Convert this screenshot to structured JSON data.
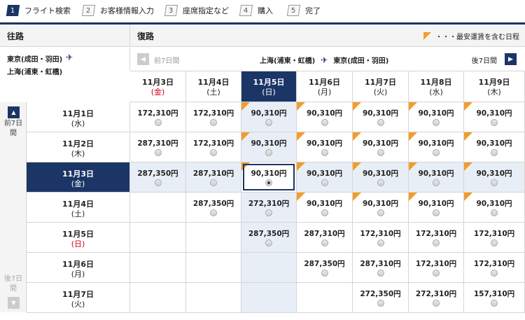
{
  "steps": [
    {
      "num": "1",
      "label": "フライト検索",
      "active": true
    },
    {
      "num": "2",
      "label": "お客様情報入力",
      "active": false
    },
    {
      "num": "3",
      "label": "座席指定など",
      "active": false
    },
    {
      "num": "4",
      "label": "購入",
      "active": false
    },
    {
      "num": "5",
      "label": "完了",
      "active": false
    }
  ],
  "outbound": {
    "title": "往路",
    "from": "東京(成田・羽田)",
    "to": "上海(浦東・虹橋)"
  },
  "return": {
    "title": "復路",
    "from": "上海(浦東・虹橋)",
    "to": "東京(成田・羽田)",
    "prev_label": "前7日間",
    "next_label": "後7日間"
  },
  "legend": {
    "text": "・・・最安運賃を含む日程"
  },
  "side": {
    "up_label": "前7日間",
    "down_label": "後7日間"
  },
  "columns": [
    {
      "date": "11月3日",
      "wday": "(金)",
      "wday_red": true,
      "selected": false
    },
    {
      "date": "11月4日",
      "wday": "(土)",
      "wday_red": false,
      "selected": false
    },
    {
      "date": "11月5日",
      "wday": "(日)",
      "wday_red": false,
      "selected": true
    },
    {
      "date": "11月6日",
      "wday": "(月)",
      "wday_red": false,
      "selected": false
    },
    {
      "date": "11月7日",
      "wday": "(火)",
      "wday_red": false,
      "selected": false
    },
    {
      "date": "11月8日",
      "wday": "(水)",
      "wday_red": false,
      "selected": false
    },
    {
      "date": "11月9日",
      "wday": "(木)",
      "wday_red": false,
      "selected": false
    }
  ],
  "rows": [
    {
      "date": "11月1日",
      "wday": "(水)",
      "wday_red": false,
      "selected": false,
      "cells": [
        {
          "p": "172,310円",
          "c": false
        },
        {
          "p": "172,310円",
          "c": false
        },
        {
          "p": "90,310円",
          "c": true
        },
        {
          "p": "90,310円",
          "c": true
        },
        {
          "p": "90,310円",
          "c": true
        },
        {
          "p": "90,310円",
          "c": true
        },
        {
          "p": "90,310円",
          "c": true
        }
      ]
    },
    {
      "date": "11月2日",
      "wday": "(木)",
      "wday_red": false,
      "selected": false,
      "cells": [
        {
          "p": "287,310円",
          "c": false
        },
        {
          "p": "172,310円",
          "c": false
        },
        {
          "p": "90,310円",
          "c": true
        },
        {
          "p": "90,310円",
          "c": true
        },
        {
          "p": "90,310円",
          "c": true
        },
        {
          "p": "90,310円",
          "c": true
        },
        {
          "p": "90,310円",
          "c": true
        }
      ]
    },
    {
      "date": "11月3日",
      "wday": "(金)",
      "wday_red": false,
      "selected": true,
      "cells": [
        {
          "p": "287,350円",
          "c": false
        },
        {
          "p": "287,310円",
          "c": false
        },
        {
          "p": "90,310円",
          "c": true,
          "sel": true
        },
        {
          "p": "90,310円",
          "c": true
        },
        {
          "p": "90,310円",
          "c": true
        },
        {
          "p": "90,310円",
          "c": true
        },
        {
          "p": "90,310円",
          "c": true
        }
      ]
    },
    {
      "date": "11月4日",
      "wday": "(土)",
      "wday_red": false,
      "selected": false,
      "cells": [
        {
          "p": "",
          "c": false
        },
        {
          "p": "287,350円",
          "c": false
        },
        {
          "p": "272,310円",
          "c": false
        },
        {
          "p": "90,310円",
          "c": true
        },
        {
          "p": "90,310円",
          "c": true
        },
        {
          "p": "90,310円",
          "c": true
        },
        {
          "p": "90,310円",
          "c": true
        }
      ]
    },
    {
      "date": "11月5日",
      "wday": "(日)",
      "wday_red": true,
      "selected": false,
      "cells": [
        {
          "p": "",
          "c": false
        },
        {
          "p": "",
          "c": false
        },
        {
          "p": "287,350円",
          "c": false
        },
        {
          "p": "287,310円",
          "c": false
        },
        {
          "p": "172,310円",
          "c": false
        },
        {
          "p": "172,310円",
          "c": false
        },
        {
          "p": "172,310円",
          "c": false
        }
      ]
    },
    {
      "date": "11月6日",
      "wday": "(月)",
      "wday_red": false,
      "selected": false,
      "cells": [
        {
          "p": "",
          "c": false
        },
        {
          "p": "",
          "c": false
        },
        {
          "p": "",
          "c": false
        },
        {
          "p": "287,350円",
          "c": false
        },
        {
          "p": "287,310円",
          "c": false
        },
        {
          "p": "172,310円",
          "c": false
        },
        {
          "p": "172,310円",
          "c": false
        }
      ]
    },
    {
      "date": "11月7日",
      "wday": "(火)",
      "wday_red": false,
      "selected": false,
      "cells": [
        {
          "p": "",
          "c": false
        },
        {
          "p": "",
          "c": false
        },
        {
          "p": "",
          "c": false
        },
        {
          "p": "",
          "c": false
        },
        {
          "p": "272,350円",
          "c": false
        },
        {
          "p": "272,310円",
          "c": false
        },
        {
          "p": "157,310円",
          "c": false
        }
      ]
    }
  ],
  "colors": {
    "navy": "#1b3566",
    "orange": "#f39c2b",
    "highlight": "#e8eef6",
    "red": "#d0021b"
  }
}
